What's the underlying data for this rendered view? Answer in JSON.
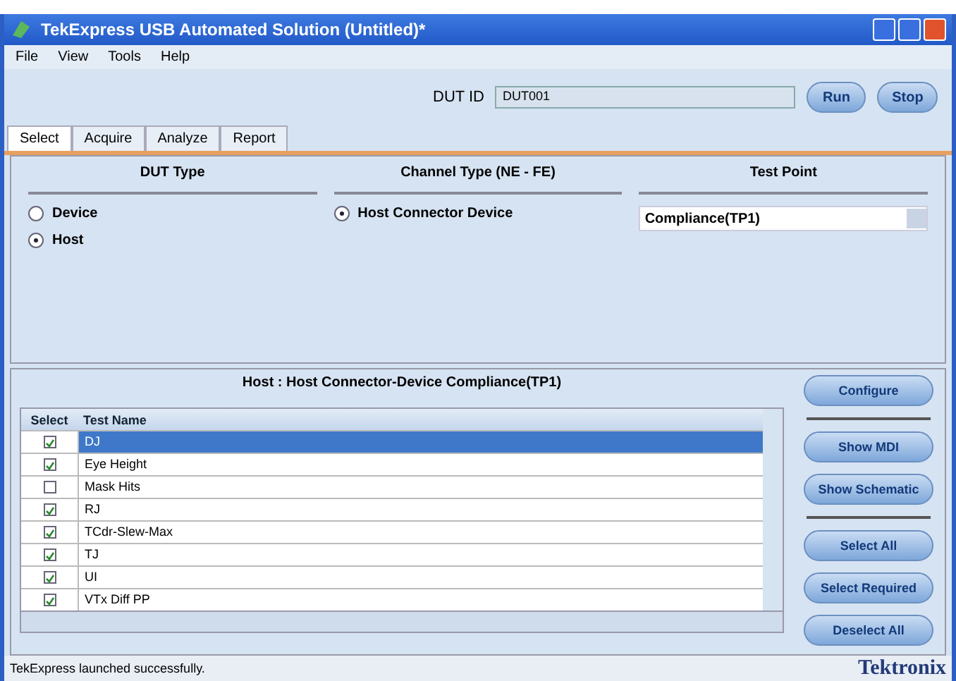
{
  "window": {
    "title": "TekExpress USB Automated Solution (Untitled)*"
  },
  "menu": [
    "File",
    "View",
    "Tools",
    "Help"
  ],
  "dut": {
    "label": "DUT ID",
    "value": "DUT001"
  },
  "run_buttons": [
    "Run",
    "Stop"
  ],
  "tabs": [
    {
      "label": "Select",
      "selected": true
    },
    {
      "label": "Acquire",
      "selected": false
    },
    {
      "label": "Analyze",
      "selected": false
    },
    {
      "label": "Report",
      "selected": false
    }
  ],
  "dut_type": {
    "heading": "DUT Type",
    "options": [
      {
        "label": "Device",
        "selected": false
      },
      {
        "label": "Host",
        "selected": true
      }
    ]
  },
  "channel_type": {
    "heading": "Channel Type (NE - FE)",
    "options": [
      {
        "label": "Host Connector Device",
        "selected": true
      }
    ]
  },
  "test_point": {
    "heading": "Test Point",
    "value": "Compliance(TP1)"
  },
  "tests": {
    "title": "Host : Host Connector-Device Compliance(TP1)",
    "columns": [
      "Select",
      "Test Name"
    ],
    "rows": [
      {
        "name": "DJ",
        "checked": true,
        "selected": true
      },
      {
        "name": "Eye Height",
        "checked": true,
        "selected": false
      },
      {
        "name": "Mask Hits",
        "checked": false,
        "selected": false
      },
      {
        "name": "RJ",
        "checked": true,
        "selected": false
      },
      {
        "name": "TCdr-Slew-Max",
        "checked": true,
        "selected": false
      },
      {
        "name": "TJ",
        "checked": true,
        "selected": false
      },
      {
        "name": "UI",
        "checked": true,
        "selected": false
      },
      {
        "name": "VTx Diff PP",
        "checked": true,
        "selected": false
      }
    ]
  },
  "side_buttons": [
    {
      "label": "Configure",
      "divider_after": true
    },
    {
      "label": "Show MDI",
      "divider_after": false
    },
    {
      "label": "Show Schematic",
      "divider_after": true
    },
    {
      "label": "Select All",
      "divider_after": false
    },
    {
      "label": "Select Required",
      "divider_after": false
    },
    {
      "label": "Deselect All",
      "divider_after": false
    }
  ],
  "status_bar": {
    "message": "TekExpress launched successfully.",
    "brand": "Tektronix"
  }
}
